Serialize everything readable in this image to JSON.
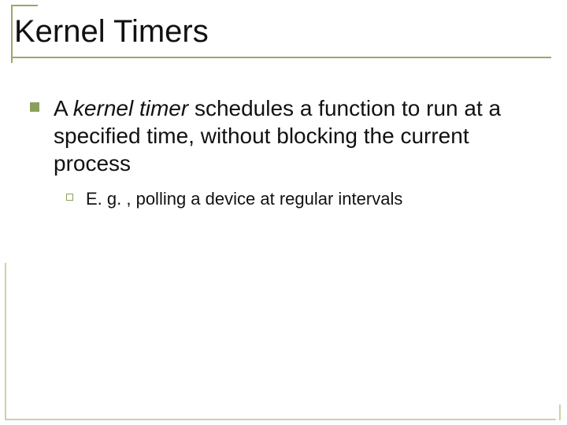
{
  "title": "Kernel Timers",
  "bullets": {
    "l1": {
      "pre": "A ",
      "em": "kernel timer",
      "post": " schedules a function to run at a specified time, without blocking the current process"
    },
    "l2": "E. g. , polling a device at regular intervals"
  }
}
